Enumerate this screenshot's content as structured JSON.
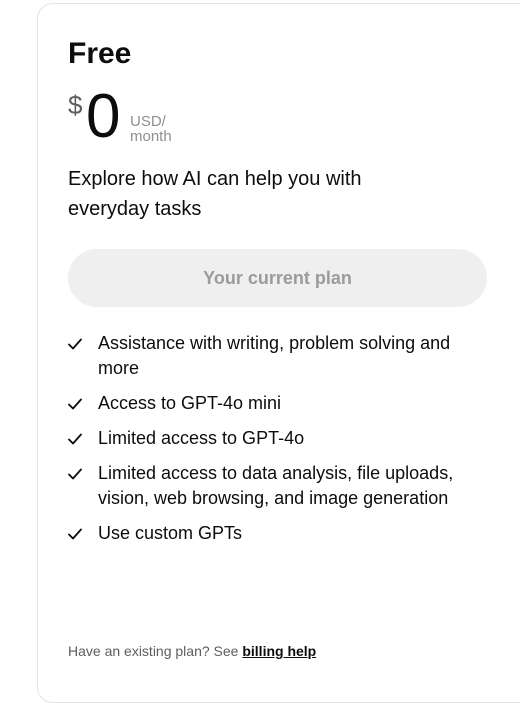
{
  "plan": {
    "name": "Free",
    "currency_symbol": "$",
    "price": "0",
    "period_line1": "USD/",
    "period_line2": "month",
    "tagline": "Explore how AI can help you with everyday tasks",
    "button_label": "Your current plan"
  },
  "features": [
    {
      "icon": "check-icon",
      "text": "Assistance with writing, problem solving and more"
    },
    {
      "icon": "check-icon",
      "text": "Access to GPT-4o mini"
    },
    {
      "icon": "check-icon",
      "text": "Limited access to GPT-4o"
    },
    {
      "icon": "check-icon",
      "text": "Limited access to data analysis, file uploads, vision, web browsing, and image generation"
    },
    {
      "icon": "check-icon",
      "text": "Use custom GPTs"
    }
  ],
  "footer": {
    "prefix": "Have an existing plan? See ",
    "link_label": "billing help"
  },
  "colors": {
    "text": "#0d0d0d",
    "muted": "#8f8f8f",
    "button_bg": "#efefef",
    "button_text": "#9b9b9b",
    "card_border": "#e3e3e3"
  }
}
